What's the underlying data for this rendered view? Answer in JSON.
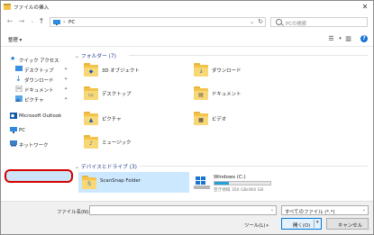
{
  "window": {
    "title": "ファイルの挿入"
  },
  "address": {
    "crumb": "PC"
  },
  "search": {
    "placeholder": "PCの検索"
  },
  "toolbar": {
    "organize_label": "整理 ▾"
  },
  "sidebar": {
    "items": [
      {
        "label": "クイック アクセス",
        "icon": "star-icon"
      },
      {
        "label": "デスクトップ",
        "icon": "desktop-icon",
        "pinned": true
      },
      {
        "label": "ダウンロード",
        "icon": "download-icon",
        "pinned": true
      },
      {
        "label": "ドキュメント",
        "icon": "document-icon",
        "pinned": true
      },
      {
        "label": "ピクチャ",
        "icon": "picture-icon",
        "pinned": true
      },
      {
        "label": "Microsoft Outlook",
        "icon": "outlook-icon"
      },
      {
        "label": "PC",
        "icon": "pc-icon",
        "selected": true
      },
      {
        "label": "ネットワーク",
        "icon": "network-icon"
      }
    ]
  },
  "content": {
    "folders_header": "フォルダー (7)",
    "folders": [
      {
        "label": "3D オブジェクト",
        "icon": "3d-objects-icon"
      },
      {
        "label": "ダウンロード",
        "icon": "download-folder-icon"
      },
      {
        "label": "デスクトップ",
        "icon": "desktop-folder-icon"
      },
      {
        "label": "ドキュメント",
        "icon": "documents-folder-icon"
      },
      {
        "label": "ピクチャ",
        "icon": "pictures-folder-icon"
      },
      {
        "label": "ビデオ",
        "icon": "videos-folder-icon"
      },
      {
        "label": "ミュージック",
        "icon": "music-folder-icon"
      }
    ],
    "drives_header": "デバイスとドライブ (3)",
    "drives": [
      {
        "label": "ScanSnap Folder",
        "icon": "scansnap-folder-icon"
      },
      {
        "label": "Windows (C:)",
        "icon": "windows-drive-icon",
        "free_text": "空き領域 350 GB/464 GB",
        "used_fraction": 0.25
      }
    ]
  },
  "bottom": {
    "filename_label": "ファイル名(N):",
    "filename_value": "",
    "filetype_value": "すべてのファイル (*.*)",
    "tools_label": "ツール(L)",
    "open_label": "開く(O)",
    "cancel_label": "キャンセル"
  },
  "colors": {
    "selection": "#cce8ff",
    "accent": "#0078d7",
    "highlight_ring": "#d40000"
  }
}
